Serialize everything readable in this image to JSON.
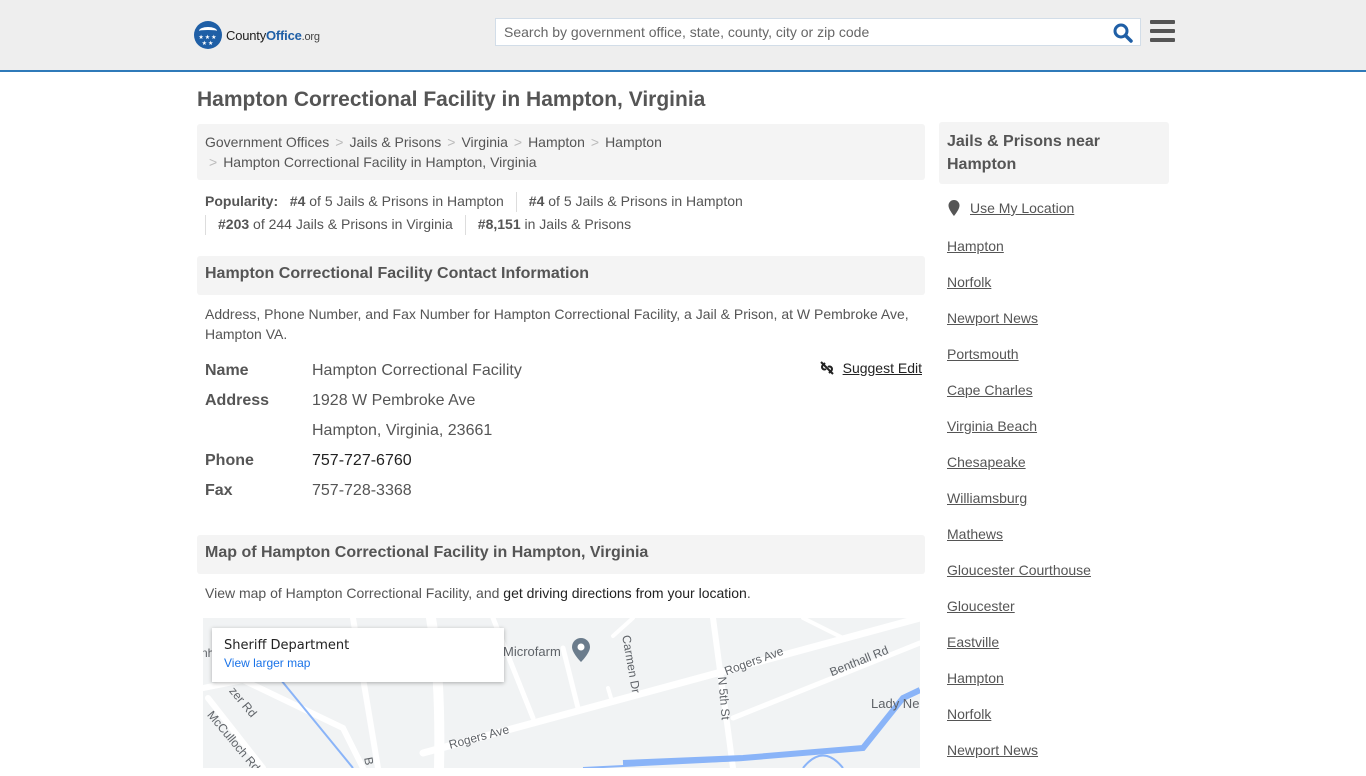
{
  "header": {
    "logo": {
      "county": "County",
      "office": "Office",
      "org": ".org"
    },
    "search_placeholder": "Search by government office, state, county, city or zip code",
    "icons": {
      "search": "search-icon",
      "menu": "hamburger-menu-icon",
      "logo": "eagle-stars-logo"
    }
  },
  "page_title": "Hampton Correctional Facility in Hampton, Virginia",
  "breadcrumb": [
    "Government Offices",
    "Jails & Prisons",
    "Virginia",
    "Hampton",
    "Hampton",
    "Hampton Correctional Facility in Hampton, Virginia"
  ],
  "popularity": {
    "label": "Popularity:",
    "items": [
      {
        "rank": "#4",
        "text": "of 5 Jails & Prisons in Hampton"
      },
      {
        "rank": "#4",
        "text": "of 5 Jails & Prisons in Hampton"
      },
      {
        "rank": "#203",
        "text": "of 244 Jails & Prisons in Virginia"
      },
      {
        "rank": "#8,151",
        "text": "in Jails & Prisons"
      }
    ]
  },
  "contact": {
    "heading": "Hampton Correctional Facility Contact Information",
    "description": "Address, Phone Number, and Fax Number for Hampton Correctional Facility, a Jail & Prison, at W Pembroke Ave, Hampton VA.",
    "suggest_edit": "Suggest Edit",
    "fields": {
      "name_label": "Name",
      "name": "Hampton Correctional Facility",
      "address_label": "Address",
      "address_line1": "1928 W Pembroke Ave",
      "address_line2": "Hampton, Virginia, 23661",
      "phone_label": "Phone",
      "phone": "757-727-6760",
      "fax_label": "Fax",
      "fax": "757-728-3368"
    }
  },
  "map": {
    "heading": "Map of Hampton Correctional Facility in Hampton, Virginia",
    "desc_prefix": "View map of Hampton Correctional Facility, and ",
    "desc_link": "get driving directions from your location",
    "desc_suffix": ".",
    "card_title": "Sheriff Department",
    "card_link": "View larger map",
    "labels": {
      "microfarm": "Microfarm",
      "carmen": "Carmen Dr",
      "rogers1": "Rogers Ave",
      "rogers2": "Rogers Ave",
      "benthall": "Benthall Rd",
      "n5th": "N 5th St",
      "lady": "Lady Ne",
      "mcculloch": "McCulloch Rd",
      "zer": "zer Rd",
      "nh": "nh",
      "b": "B"
    }
  },
  "sidebar": {
    "heading": "Jails & Prisons near Hampton",
    "use_location": "Use My Location",
    "links": [
      "Hampton",
      "Norfolk",
      "Newport News",
      "Portsmouth",
      "Cape Charles",
      "Virginia Beach",
      "Chesapeake",
      "Williamsburg",
      "Mathews",
      "Gloucester Courthouse",
      "Gloucester",
      "Eastville",
      "Hampton",
      "Norfolk",
      "Newport News"
    ]
  },
  "colors": {
    "brand_blue": "#1f5fa6",
    "header_border": "#2f7ab9",
    "header_bg": "#eeeeee",
    "panel_bg": "#f4f4f4",
    "text": "#555555",
    "map_link": "#1a73e8"
  }
}
